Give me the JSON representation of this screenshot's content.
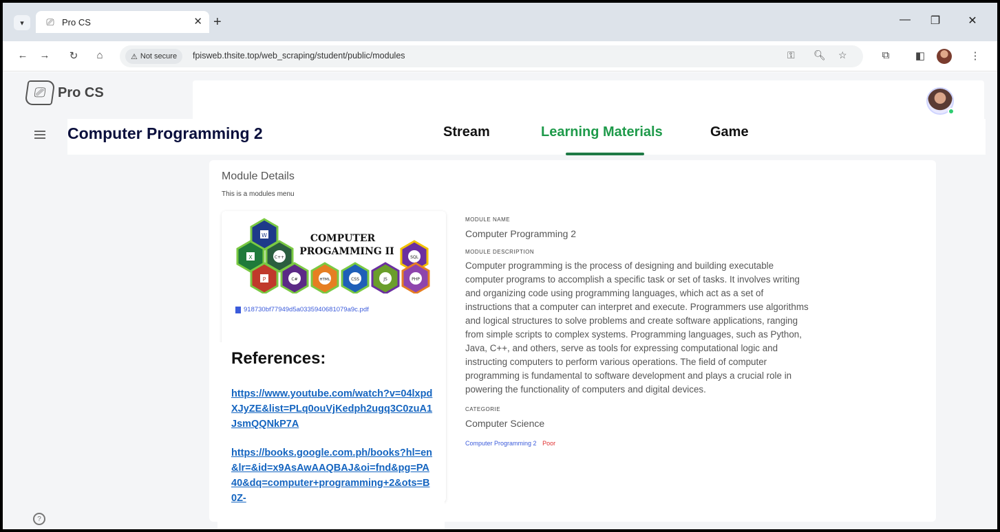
{
  "browser": {
    "tab_title": "Pro CS",
    "security_label": "Not secure",
    "url": "fpisweb.thsite.top/web_scraping/student/public/modules"
  },
  "app": {
    "brand": "Pro CS",
    "course_title": "Computer Programming 2",
    "nav_tabs": [
      "Stream",
      "Learning Materials",
      "Game"
    ],
    "active_tab": "Learning Materials"
  },
  "card": {
    "title": "Module Details",
    "subtitle": "This is a modules menu"
  },
  "module": {
    "image_title_line1": "COMPUTER",
    "image_title_line2": "PROGAMMING II",
    "image_tags": [
      "W",
      "X",
      "C++",
      "SQL",
      "P",
      "C#",
      "HTML",
      "CSS",
      "JS",
      "PHP"
    ],
    "pdf_name": "918730bf77949d5a0335940681079a9c.pdf",
    "name_label": "MODULE NAME",
    "name": "Computer Programming 2",
    "description_label": "MODULE DESCRIPTION",
    "description": "Computer programming is the process of designing and building executable computer programs to accomplish a specific task or set of tasks. It involves writing and organizing code using programming languages, which act as a set of instructions that a computer can interpret and execute. Programmers use algorithms and logical structures to solve problems and create software applications, ranging from simple scripts to complex systems. Programming languages, such as Python, Java, C++, and others, serve as tools for expressing computational logic and instructing computers to perform various operations. The field of computer programming is fundamental to software development and plays a crucial role in powering the functionality of computers and digital devices.",
    "category_label": "CATEGORIE",
    "category": "Computer Science",
    "tag_course": "Computer Programming 2",
    "tag_status": "Poor"
  },
  "references": {
    "heading": "References:",
    "links": [
      "https://www.youtube.com/watch?v=04lxpdXJyZE&list=PLq0ouVjKedph2ugq3C0zuA1JsmQQNkP7A",
      "https://books.google.com.ph/books?hl=en&lr=&id=x9AsAwAAQBAJ&oi=fnd&pg=PA40&dq=computer+programming+2&ots=B0Z-"
    ]
  },
  "colors": {
    "active_tab": "#1e9a4a",
    "link": "#1565c0",
    "status_poor": "#e03131"
  }
}
